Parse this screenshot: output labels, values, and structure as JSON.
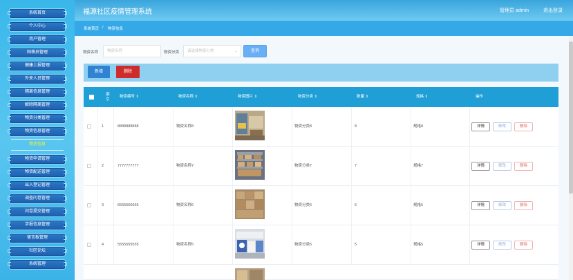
{
  "app": {
    "title": "福源社区疫情管理系统",
    "user_label": "管理员 admin",
    "logout_label": "退出登录"
  },
  "sidebar": {
    "items": [
      {
        "label": "系统首页"
      },
      {
        "label": "个人中心"
      },
      {
        "label": "用户管理"
      },
      {
        "label": "网格员管理"
      },
      {
        "label": "健康上报管理"
      },
      {
        "label": "外来人员管理"
      },
      {
        "label": "隔离信息管理"
      },
      {
        "label": "解除隔离管理"
      },
      {
        "label": "物资分类管理"
      },
      {
        "label": "物资信息管理"
      }
    ],
    "active_label": "物资信息",
    "items_after": [
      {
        "label": "物资申请管理"
      },
      {
        "label": "物资配送管理"
      },
      {
        "label": "出入登记管理"
      },
      {
        "label": "调查问卷管理"
      },
      {
        "label": "问卷提交管理"
      },
      {
        "label": "学报信息管理"
      },
      {
        "label": "留言板管理"
      },
      {
        "label": "社区论坛"
      },
      {
        "label": "系统管理"
      }
    ]
  },
  "breadcrumb": {
    "home": "系统首页",
    "separator": "/",
    "current": "物资信息"
  },
  "search": {
    "name_label": "物资名称",
    "name_placeholder": "物资名称",
    "category_label": "物资分类",
    "category_placeholder": "请选择物资分类",
    "query_button": "查询"
  },
  "actions": {
    "add": "新增",
    "delete": "删除"
  },
  "table": {
    "headers": {
      "index_line1": "索",
      "index_line2": "引",
      "code": "物资编号 ⇕",
      "name": "物资名称 ⇕",
      "image": "物资图片 ⇕",
      "category": "物资分类 ⇕",
      "quantity": "数量 ⇕",
      "spec": "规格 ⇕",
      "ops": "操作"
    },
    "rows": [
      {
        "index": "1",
        "code": "8888888888",
        "name": "物资名称8",
        "category": "物资分类8",
        "quantity": "8",
        "spec": "规格8"
      },
      {
        "index": "2",
        "code": "7777777777",
        "name": "物资名称7",
        "category": "物资分类7",
        "quantity": "7",
        "spec": "规格7"
      },
      {
        "index": "3",
        "code": "6666666666",
        "name": "物资名称6",
        "category": "物资分类6",
        "quantity": "6",
        "spec": "规格6"
      },
      {
        "index": "4",
        "code": "5555555555",
        "name": "物资名称5",
        "category": "物资分类5",
        "quantity": "5",
        "spec": "规格5"
      }
    ],
    "op_labels": {
      "detail": "详情",
      "edit": "修改",
      "remove": "删除"
    }
  }
}
